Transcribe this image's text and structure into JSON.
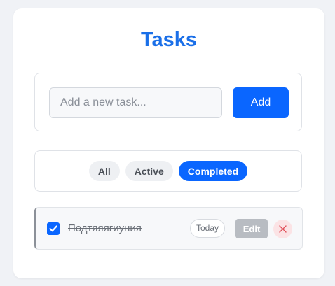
{
  "app": {
    "title": "Tasks"
  },
  "add_form": {
    "input_placeholder": "Add a new task...",
    "input_value": "",
    "add_label": "Add"
  },
  "filters": [
    {
      "label": "All",
      "active": false
    },
    {
      "label": "Active",
      "active": false
    },
    {
      "label": "Completed",
      "active": true
    }
  ],
  "tasks": [
    {
      "text": "Подтяяягиуния",
      "completed": true,
      "date": "Today",
      "edit_label": "Edit",
      "delete_icon": "close-icon"
    }
  ],
  "colors": {
    "accent": "#0a66ff",
    "title": "#1a6fe8",
    "delete_bg": "#fbe3e5",
    "delete_icon": "#e0505a"
  }
}
